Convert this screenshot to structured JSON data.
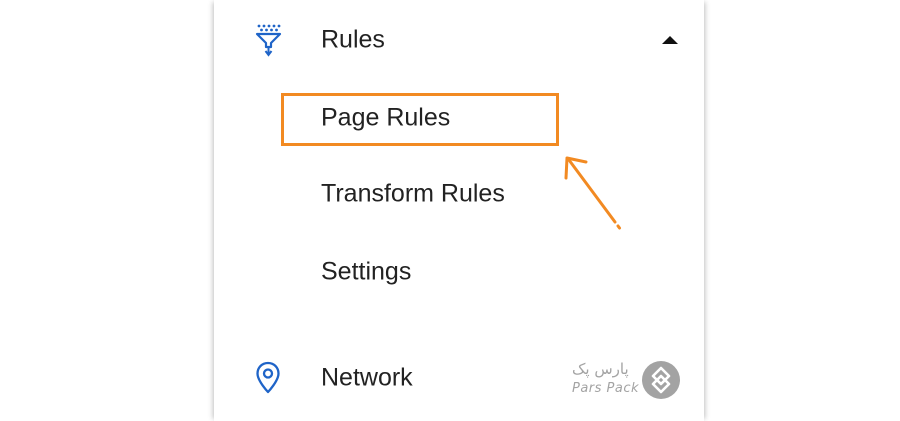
{
  "menu": {
    "rules": {
      "label": "Rules",
      "icon": "funnel-icon",
      "expanded": true
    },
    "sub_items": [
      {
        "label": "Page Rules",
        "highlighted": true
      },
      {
        "label": "Transform Rules",
        "highlighted": false
      },
      {
        "label": "Settings",
        "highlighted": false
      }
    ],
    "network": {
      "label": "Network",
      "icon": "location-pin-icon"
    }
  },
  "watermark": {
    "brand_fa": "پارس پک",
    "brand_en": "Pars Pack"
  },
  "colors": {
    "accent_icon": "#1f64c8",
    "highlight": "#f28a22",
    "text": "#222222",
    "watermark": "#9a9a9a"
  }
}
